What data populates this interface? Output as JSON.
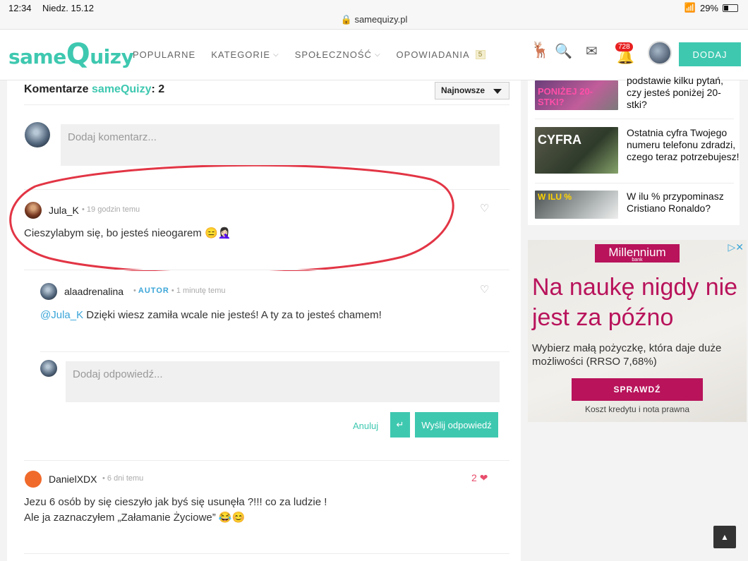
{
  "status_bar": {
    "time": "12:34",
    "date": "Niedz. 15.12",
    "battery": "29%",
    "url": "samequizy.pl"
  },
  "header": {
    "logo": "sameQuizy",
    "nav": [
      {
        "label": "POPULARNE"
      },
      {
        "label": "KATEGORIE"
      },
      {
        "label": "SPOŁECZNOŚĆ"
      },
      {
        "label": "OPOWIADANIA",
        "badge": "5"
      }
    ],
    "notifications": "728",
    "add_button": "DODAJ"
  },
  "comments": {
    "title_prefix": "Komentarze",
    "brand": "sameQuizy",
    "count_suffix": ": 2",
    "sort": "Najnowsze",
    "placeholder": "Dodaj komentarz...",
    "reply_placeholder": "Dodaj odpowiedź...",
    "cancel": "Anuluj",
    "enter": "↵",
    "send": "Wyślij odpowiedź",
    "items": [
      {
        "name": "Jula_K",
        "meta": "19 godzin temu",
        "text": "Cieszylabym się, bo jesteś nieogarem 😑🤦🏻‍♀️"
      },
      {
        "name": "alaadrenalina",
        "role": "AUTOR",
        "meta": "1 minutę temu",
        "mention": "@Jula_K",
        "text": " Dzięki wiesz zamiła wcale nie jesteś! A ty za to jesteś chamem!"
      },
      {
        "name": "DanielXDX",
        "meta": "6 dni temu",
        "likes": "2",
        "text_line1": "Jezu 6 osób by się cieszyło jak byś się usunęła ?!!! co za ludzie !",
        "text_line2": "Ale ja zaznaczyłem „Załamanie Życiowe” 😂😊"
      }
    ]
  },
  "sidebar": {
    "quizzes": [
      {
        "title": "podstawie kilku pytań, czy jesteś poniżej 20-stki?",
        "thumb": "PONIŻEJ 20-STKI?"
      },
      {
        "title": "Ostatnia cyfra Twojego numeru telefonu zdradzi, czego teraz potrzebujesz!",
        "thumb": "CYFRA"
      },
      {
        "title": "W ilu % przypominasz Cristiano Ronaldo?",
        "thumb": "W ILU %"
      }
    ]
  },
  "ad": {
    "brand": "Millennium",
    "brand_sub": "bank",
    "headline": "Na naukę nigdy nie jest za późno",
    "sub": "Wybierz małą pożyczkę, która daje duże możliwości (RRSO 7,68%)",
    "button": "SPRAWDŹ",
    "footer": "Koszt kredytu i nota prawna"
  },
  "colors": {
    "accent": "#3ec8b0",
    "brand_ad": "#b8135b",
    "mention": "#3aa5d8",
    "like": "#e84d6c"
  }
}
